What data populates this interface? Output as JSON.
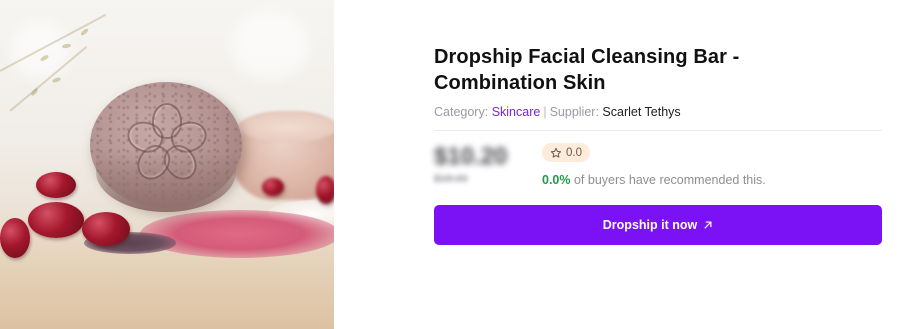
{
  "product": {
    "title_line1": "Dropship Facial Cleansing Bar -",
    "title_line2": "Combination Skin",
    "image_icon": "soap-bar-image",
    "category_label": "Category:",
    "category_value": "Skincare",
    "separator": "|",
    "supplier_label": "Supplier:",
    "supplier_value": "Scarlet Tethys"
  },
  "pricing": {
    "price": "$10.20",
    "original_price": "$18.00",
    "rating_icon": "star-icon",
    "rating": "0.0",
    "recommend_pct": "0.0%",
    "recommend_text": " of buyers have recommended this."
  },
  "cta": {
    "label": "Dropship it now",
    "icon": "arrow-up-right-icon"
  },
  "colors": {
    "accent": "#7b12f5",
    "link": "#7a1ff0",
    "positive": "#1f9a4a",
    "badge_bg": "#fdebdc"
  }
}
